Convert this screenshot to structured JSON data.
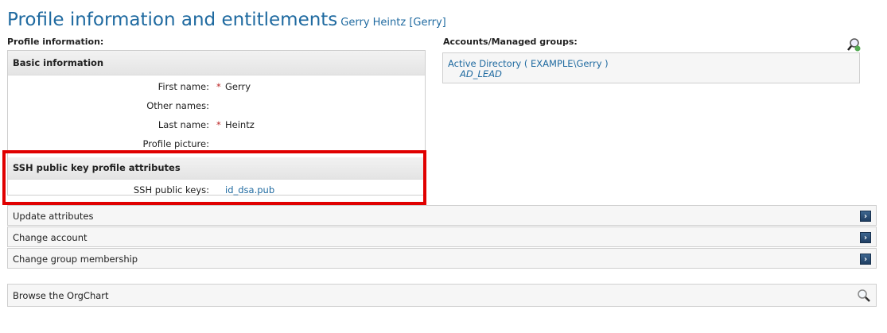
{
  "header": {
    "title": "Profile information and entitlements",
    "user": "Gerry Heintz [Gerry]"
  },
  "profile": {
    "label": "Profile information:",
    "basic": {
      "title": "Basic information",
      "fields": [
        {
          "label": "First name:",
          "required": true,
          "value": "Gerry"
        },
        {
          "label": "Other names:",
          "required": false,
          "value": ""
        },
        {
          "label": "Last name:",
          "required": true,
          "value": "Heintz"
        },
        {
          "label": "Profile picture:",
          "required": false,
          "value": ""
        }
      ]
    },
    "ssh": {
      "title": "SSH public key profile attributes",
      "label": "SSH public keys:",
      "value": "id_dsa.pub"
    },
    "required_marker": "*"
  },
  "accounts": {
    "label": "Accounts/Managed groups:",
    "system": "Active Directory",
    "account": "( EXAMPLE\\Gerry )",
    "group": "AD_LEAD",
    "icon": "search-add-icon"
  },
  "actions": [
    {
      "label": "Update attributes",
      "icon": "chevron-right-icon"
    },
    {
      "label": "Change account",
      "icon": "chevron-right-icon"
    },
    {
      "label": "Change group membership",
      "icon": "chevron-right-icon"
    }
  ],
  "browse": {
    "label": "Browse the OrgChart",
    "icon": "magnifier-icon"
  },
  "colors": {
    "accent": "#1f6aa0",
    "highlight": "#e00000",
    "button": "#2b4a6e"
  }
}
